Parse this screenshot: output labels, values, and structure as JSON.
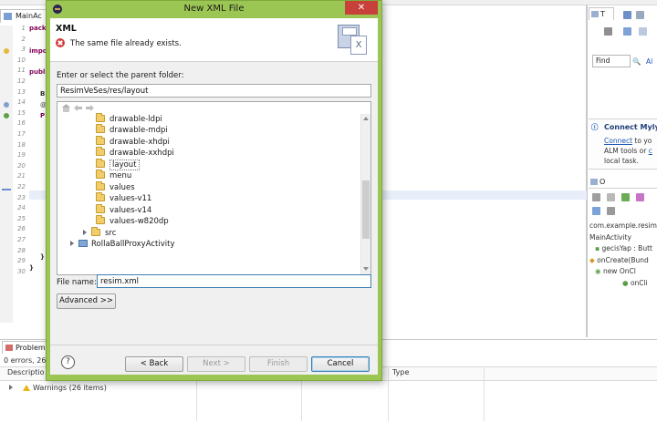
{
  "ide": {
    "editor_tab": "MainAc",
    "line_numbers": [
      "1",
      "2",
      "3",
      "10",
      "11",
      "12",
      "13",
      "14",
      "15",
      "16",
      "17",
      "18",
      "19",
      "20",
      "21",
      "22",
      "23",
      "24",
      "25",
      "26",
      "27",
      "28",
      "29",
      "30"
    ],
    "code_fragments": [
      "pack",
      "impo",
      "publi",
      "B",
      "@",
      "P",
      "}",
      "}"
    ],
    "right_tab": "T",
    "find_label": "Find",
    "all_label": "Al",
    "mylyn_title": "Connect Myly",
    "mylyn_line1": "Connect",
    "mylyn_line1_rest": " to yo",
    "mylyn_line2": "ALM tools or ",
    "mylyn_line2_link": "c",
    "mylyn_line3": "local task.",
    "outline_tab": "O",
    "outline_items": [
      "com.example.resim",
      "MainActivity",
      "gecisYap : Butt",
      "onCreate(Bund",
      "new OnCl",
      "onCli"
    ],
    "problems_tab": "Problem",
    "problems_summary": "0 errors, 26 w",
    "problems_columns": [
      "Descriptio",
      "Type"
    ],
    "problems_row": "Warnings (26 items)"
  },
  "dialog": {
    "title": "New XML File",
    "close_label": "✕",
    "header_title": "XML",
    "error_message": "The same file already exists.",
    "folder_label": "Enter or select the parent folder:",
    "folder_value": "ResimVeSes/res/layout",
    "tree_items": [
      {
        "label": "drawable-ldpi",
        "type": "folder"
      },
      {
        "label": "drawable-mdpi",
        "type": "folder"
      },
      {
        "label": "drawable-xhdpi",
        "type": "folder"
      },
      {
        "label": "drawable-xxhdpi",
        "type": "folder"
      },
      {
        "label": "layout",
        "type": "folder",
        "selected": true
      },
      {
        "label": "menu",
        "type": "folder"
      },
      {
        "label": "values",
        "type": "folder"
      },
      {
        "label": "values-v11",
        "type": "folder"
      },
      {
        "label": "values-v14",
        "type": "folder"
      },
      {
        "label": "values-w820dp",
        "type": "folder"
      },
      {
        "label": "src",
        "type": "collapsed-folder"
      },
      {
        "label": "RollaBallProxyActivity",
        "type": "project"
      }
    ],
    "file_name_label": "File name:",
    "file_name_value": "resim.xml",
    "advanced_button": "Advanced >>",
    "help_label": "?",
    "back_button": "< Back",
    "next_button": "Next >",
    "finish_button": "Finish",
    "cancel_button": "Cancel"
  },
  "colors": {
    "window_frame": "#9cc653",
    "close_button": "#c7413a",
    "error_icon": "#d23a3a",
    "folder": "#f2cd6c"
  }
}
